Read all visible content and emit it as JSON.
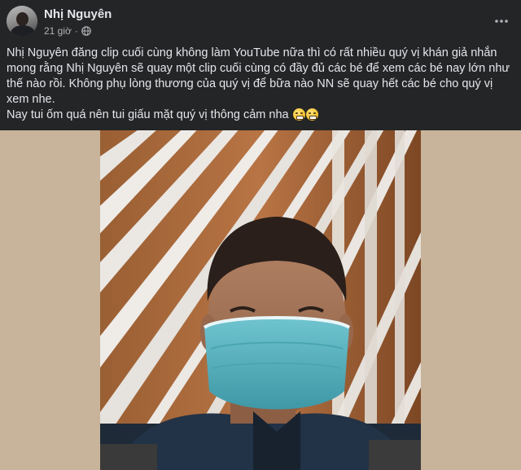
{
  "post": {
    "author": {
      "name": "Nhị Nguyên",
      "avatar_icon": "profile-photo"
    },
    "meta": {
      "time": "21 giờ",
      "separator": "·",
      "audience_icon": "globe-icon"
    },
    "menu_icon": "more-horizontal-icon",
    "text": {
      "paragraph_1": "Nhị Nguyên đăng clip cuối cùng không làm YouTube nữa thì có rất nhiều quý vị khán giả  nhắn mong rằng Nhị Nguyên sẽ quay một clip cuối cùng có đầy đủ các bé để xem các bé nay lớn như thế nào rồi. Không phụ lòng thương của quý vị để bữa nào NN sẽ quay hết các bé cho quý vị xem nhe.",
      "paragraph_2": "Nay tui ốm quá nên tui giấu mặt quý vị thông cảm nha",
      "emojis": [
        "grimacing-face",
        "grimacing-face"
      ]
    },
    "photo": {
      "subject": "selfie-man-blue-face-mask",
      "background_color": "#c8b49a"
    }
  },
  "theme": {
    "card_bg": "#242526",
    "text_primary": "#e4e6eb",
    "text_secondary": "#b0b3b8"
  }
}
